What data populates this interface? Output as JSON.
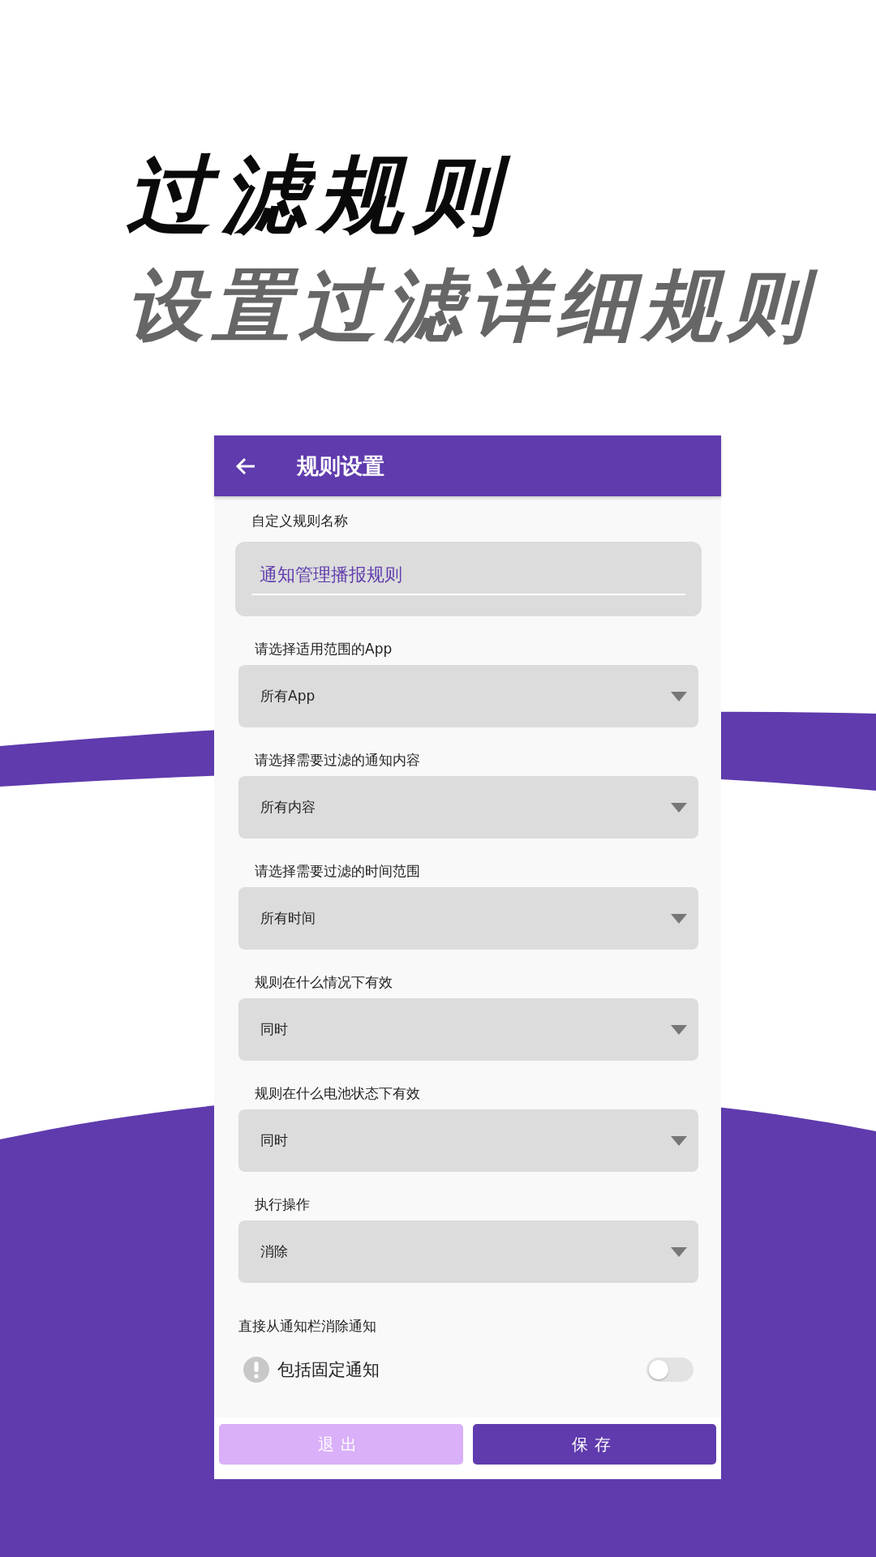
{
  "headline": {
    "title": "过滤规则",
    "subtitle": "设置过滤详细规则"
  },
  "app_bar": {
    "title": "规则设置"
  },
  "name_field": {
    "label": "自定义规则名称",
    "value": "通知管理播报规则"
  },
  "selects": [
    {
      "label": "请选择适用范围的App",
      "value": "所有App"
    },
    {
      "label": "请选择需要过滤的通知内容",
      "value": "所有内容"
    },
    {
      "label": "请选择需要过滤的时间范围",
      "value": "所有时间"
    },
    {
      "label": "规则在什么情况下有效",
      "value": "同时"
    },
    {
      "label": "规则在什么电池状态下有效",
      "value": "同时"
    },
    {
      "label": "执行操作",
      "value": "消除"
    }
  ],
  "section_title": "直接从通知栏消除通知",
  "switches": [
    {
      "label": "包括固定通知",
      "on": false
    }
  ],
  "buttons": [
    {
      "label": "退出",
      "kind": "secondary"
    },
    {
      "label": "保存",
      "kind": "primary"
    }
  ]
}
